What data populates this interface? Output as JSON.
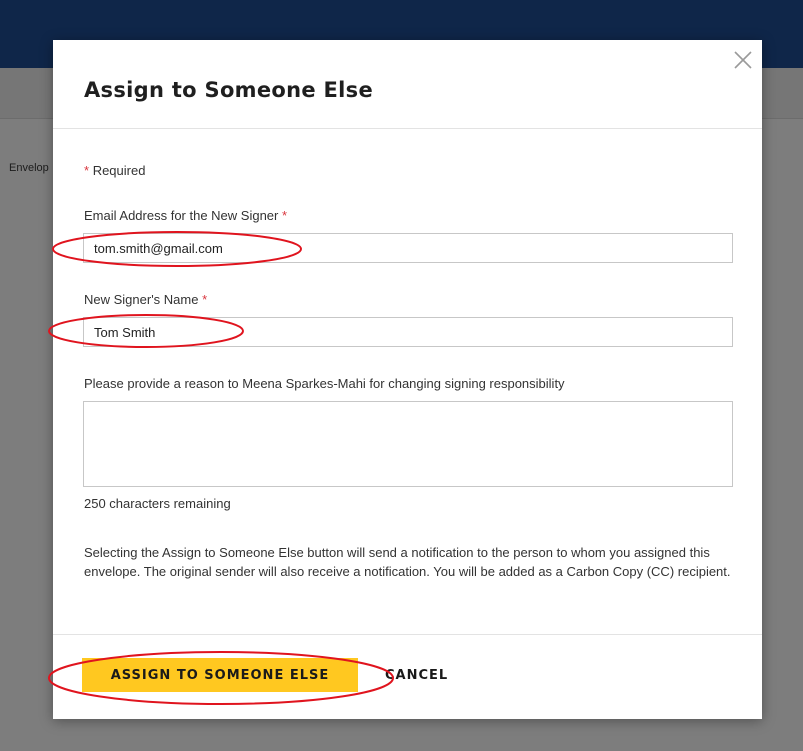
{
  "background": {
    "side_text": "Envelop"
  },
  "dialog": {
    "title": "Assign to Someone Else",
    "close_icon": "close-icon",
    "required_note": "Required",
    "required_marker": "*",
    "email": {
      "label": "Email Address for the New Signer",
      "value": "tom.smith@gmail.com"
    },
    "name": {
      "label": "New Signer's Name",
      "value": "Tom Smith"
    },
    "reason": {
      "label": "Please provide a reason to Meena Sparkes-Mahi for changing signing responsibility",
      "value": ""
    },
    "chars_remaining": "250 characters remaining",
    "info_text": "Selecting the Assign to Someone Else button will send a notification to the person to whom you assigned this envelope. The original sender will also receive a notification. You will be added as a Carbon Copy (CC) recipient.",
    "primary_button": "ASSIGN TO SOMEONE ELSE",
    "cancel_button": "CANCEL"
  },
  "colors": {
    "header_bar": "#0f2649",
    "primary_button": "#ffc820",
    "required_marker": "#d9363e",
    "annotation": "#e0141e"
  }
}
